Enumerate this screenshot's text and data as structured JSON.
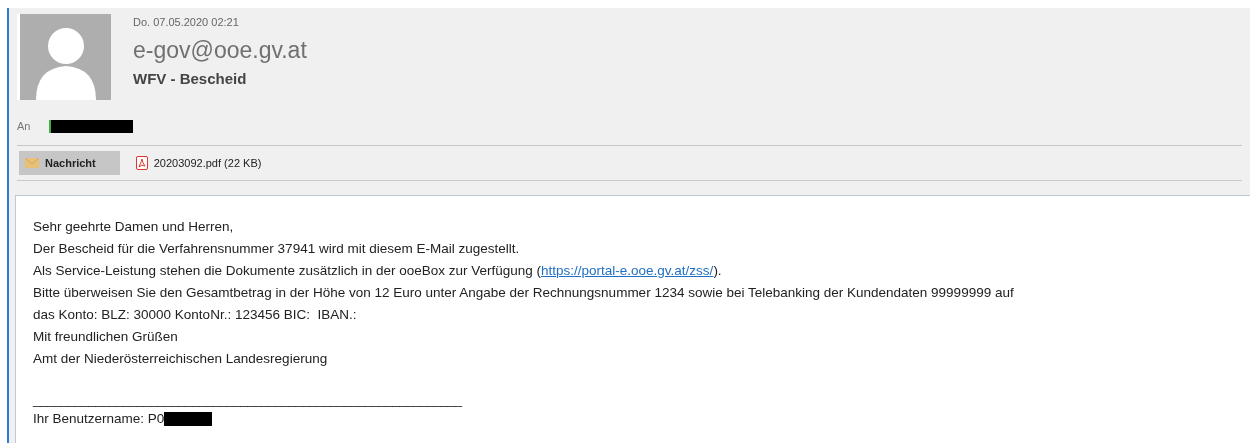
{
  "message": {
    "date": "Do. 07.05.2020 02:21",
    "sender": "e-gov@ooe.gv.at",
    "subject": "WFV - Bescheid",
    "to_label": "An"
  },
  "tabs": [
    {
      "kind": "message",
      "label": "Nachricht",
      "selected": true
    },
    {
      "kind": "pdf",
      "label": "20203092.pdf (22 KB)",
      "selected": false
    }
  ],
  "body": {
    "lines": [
      {
        "text": "Sehr geehrte Damen und Herren,"
      },
      {
        "text": "Der Bescheid für die Verfahrensnummer 37941 wird mit diesem E-Mail zugestellt."
      },
      {
        "text": "Als Service-Leistung stehen die Dokumente zusätzlich in der ooeBox zur Verfügung (",
        "link": "https://portal-e.ooe.gv.at/zss/",
        "after": ")."
      },
      {
        "text": "Bitte überweisen Sie den Gesamtbetrag in der Höhe von 12 Euro unter Angabe der Rechnungsnummer 1234 sowie bei Telebanking der Kundendaten 99999999 auf"
      },
      {
        "text": "das Konto: BLZ: 30000 KontoNr.: 123456 BIC:  IBAN.:"
      },
      {
        "text": "Mit freundlichen Grüßen"
      },
      {
        "text": "Amt der Niederösterreichischen Landesregierung"
      }
    ],
    "rule": "______________________________________________________________",
    "username_label": "Ihr Benutzername: P0"
  }
}
